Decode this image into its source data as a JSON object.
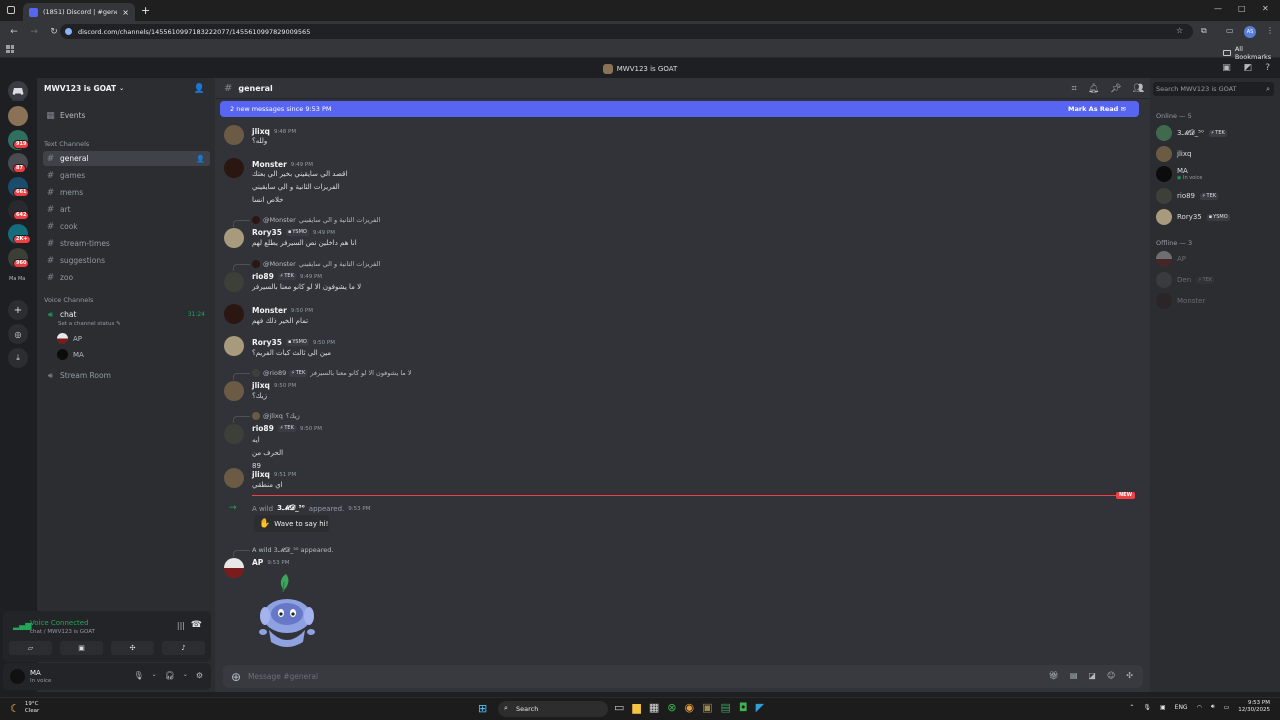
{
  "browser": {
    "tab_title": "(1851) Discord | #general | MWV",
    "url": "discord.com/channels/1455610997183222077/1455610997829009565",
    "all_bookmarks": "All Bookmarks",
    "profile_initials": "AS"
  },
  "window_title": "MWV123 is GOAT",
  "rail": {
    "badges": [
      "919",
      "87",
      "661",
      "642",
      "2K+",
      "960"
    ],
    "dm_labels": "Ma Ma"
  },
  "server": {
    "name": "MWV123 is GOAT",
    "events": "Events",
    "text_category": "Text Channels",
    "channels": [
      "general",
      "games",
      "mems",
      "art",
      "cook",
      "stream-times",
      "suggestions",
      "zoo"
    ],
    "voice_category": "Voice Channels",
    "voice_channel": "chat",
    "voice_timer": "31:24",
    "voice_status": "Set a channel status",
    "voice_users": [
      "AP",
      "MA"
    ],
    "stream_room": "Stream Room"
  },
  "voice_panel": {
    "status": "Voice Connected",
    "sub": "chat / MWV123 is GOAT"
  },
  "user_panel": {
    "name": "MA",
    "status": "In voice"
  },
  "chat": {
    "channel": "general",
    "new_messages": "2 new messages since 9:53 PM",
    "mark_read": "Mark As Read",
    "composer_placeholder": "Message #general",
    "new_label": "NEW",
    "messages": [
      {
        "author": "jlixq",
        "time": "9:48 PM",
        "lines": [
          "ولله؟"
        ]
      },
      {
        "author": "Monster",
        "time": "9:49 PM",
        "lines": [
          "اقصد الي سايقيني بخير الي بعتك",
          "الفريزات الثانية و الي سايقيني",
          "خلاص انسا"
        ]
      },
      {
        "reply_to": "@Monster",
        "reply_text": "الفريزات الثانية و الي سايقيني",
        "author": "Rory35",
        "tag": "YSMO",
        "time": "9:49 PM",
        "lines": [
          "انا هم داخلين نص السيرفر يطلع لهم"
        ]
      },
      {
        "reply_to": "@Monster",
        "reply_text": "الفريزات الثانية و الي سايقيني",
        "author": "rio89",
        "tag": "TEK",
        "time": "9:49 PM",
        "lines": [
          "لا ما يشوفون الا لو كانو معنا بالسيرفر"
        ]
      },
      {
        "author": "Monster",
        "time": "9:50 PM",
        "lines": [
          "تمام الخير ذلك فهم"
        ]
      },
      {
        "author": "Rory35",
        "tag": "YSMO",
        "time": "9:50 PM",
        "lines": [
          "مين الي ثالث كبات الفريم؟"
        ]
      },
      {
        "reply_to": "@rio89",
        "reply_tag": "TEK",
        "reply_text": "لا ما يشوفون الا لو كانو معنا بالسيرفر",
        "author": "jlixq",
        "time": "9:50 PM",
        "lines": [
          "زيك؟"
        ]
      },
      {
        "reply_to": "@jlixq",
        "reply_text": "زيك؟",
        "author": "rio89",
        "tag": "TEK",
        "time": "9:50 PM",
        "lines": [
          "ايه",
          "الحرف من",
          "89"
        ]
      },
      {
        "author": "jlixq",
        "time": "9:51 PM",
        "lines": [
          "اي منطقي"
        ]
      }
    ],
    "join_prefix": "A wild",
    "join_user": "3𝓜𝓓_⁵⁰",
    "join_suffix": "appeared.",
    "join_time": "9:53 PM",
    "wave_label": "Wave to say hi!",
    "last_reply": "A wild 3𝓜𝓓_⁵⁰ appeared.",
    "last_author": "AP",
    "last_time": "9:53 PM"
  },
  "members": {
    "search_placeholder": "Search MWV123 is GOAT",
    "online_header": "Online — 5",
    "online": [
      {
        "name": "3𝓜𝓓_⁵⁰",
        "tag": "TEK"
      },
      {
        "name": "jlixq"
      },
      {
        "name": "MA",
        "sub": "In voice"
      },
      {
        "name": "rio89",
        "tag": "TEK"
      },
      {
        "name": "Rory35",
        "tag": "YSMO"
      }
    ],
    "offline_header": "Offline — 3",
    "offline": [
      {
        "name": "AP"
      },
      {
        "name": "Den",
        "tag": "TEK"
      },
      {
        "name": "Monster"
      }
    ]
  },
  "taskbar": {
    "temp": "19°C",
    "weather": "Clear",
    "search": "Search",
    "lang": "ENG",
    "time": "9:53 PM",
    "date": "12/30/2025"
  },
  "colors": {
    "accent": "#5865f2",
    "online": "#23a55a",
    "danger": "#f23f43"
  }
}
